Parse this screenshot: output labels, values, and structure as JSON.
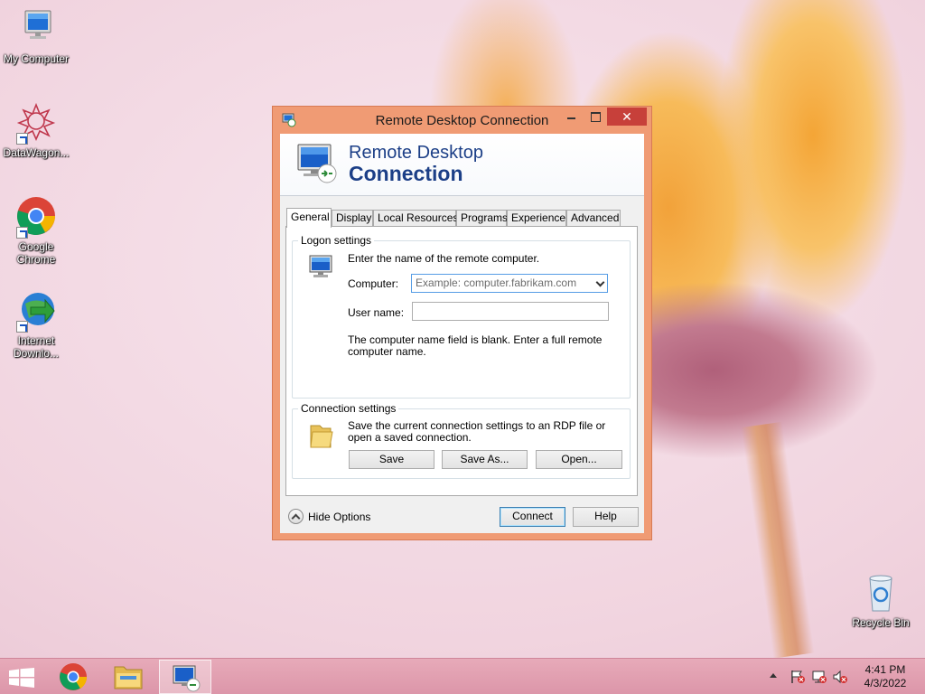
{
  "desktop": {
    "icons": [
      {
        "label": "My Computer",
        "icon": "computer-icon"
      },
      {
        "label": "DataWagon...",
        "icon": "datawagon-icon"
      },
      {
        "label": "Google Chrome",
        "icon": "chrome-icon"
      },
      {
        "label": "Internet Downlo...",
        "icon": "internet-download-manager-icon"
      },
      {
        "label": "Recycle Bin",
        "icon": "recycle-bin-icon"
      }
    ]
  },
  "window": {
    "title": "Remote Desktop Connection",
    "close_glyph": "✕",
    "banner": {
      "line1": "Remote Desktop",
      "line2": "Connection"
    },
    "tabs": [
      {
        "label": "General",
        "active": true
      },
      {
        "label": "Display"
      },
      {
        "label": "Local Resources"
      },
      {
        "label": "Programs"
      },
      {
        "label": "Experience"
      },
      {
        "label": "Advanced"
      }
    ],
    "logon": {
      "group_label": "Logon settings",
      "instruction": "Enter the name of the remote computer.",
      "computer_label": "Computer:",
      "computer_placeholder": "Example: computer.fabrikam.com",
      "username_label": "User name:",
      "username_value": "",
      "warning": "The computer name field is blank. Enter a full remote computer name."
    },
    "connection": {
      "group_label": "Connection settings",
      "description": "Save the current connection settings to an RDP file or open a saved connection.",
      "save": "Save",
      "save_as": "Save As...",
      "open": "Open..."
    },
    "footer": {
      "hide_options": "Hide Options",
      "connect": "Connect",
      "help": "Help"
    }
  },
  "taskbar": {
    "items": [
      "start-icon",
      "chrome-icon",
      "file-explorer-icon",
      "remote-desktop-icon"
    ],
    "clock_time": "4:41 PM",
    "clock_date": "4/3/2022"
  },
  "colors": {
    "titlebar": "#f09b74",
    "close_button": "#c7403a",
    "banner_text": "#1c3f87",
    "taskbar": "#e2a0b2"
  }
}
